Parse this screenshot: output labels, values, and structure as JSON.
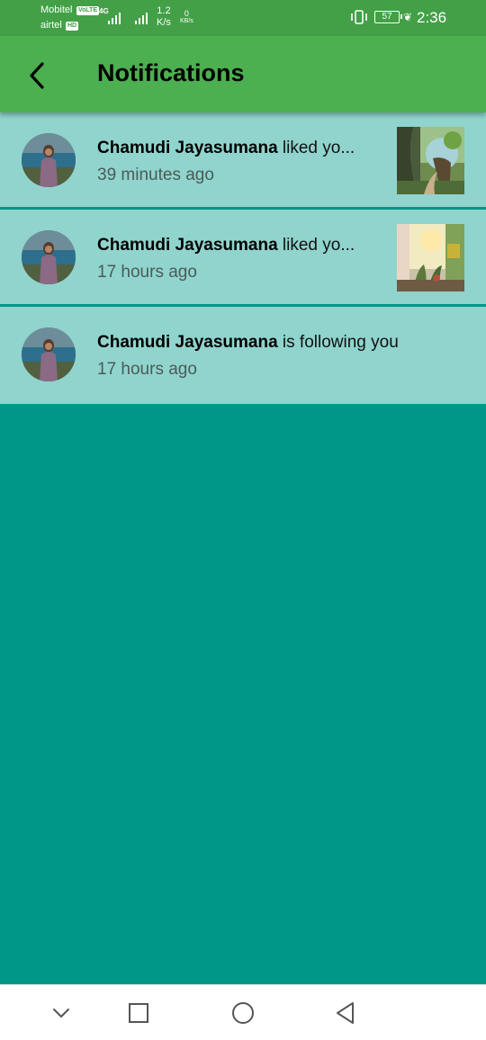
{
  "status_bar": {
    "carrier_1": "Mobitel",
    "carrier_1_tag": "VoLTE",
    "carrier_2": "airtel",
    "carrier_2_tag": "HD",
    "network_type": "4G",
    "speed_value": "1.2",
    "speed_unit": "K/s",
    "data_value": "0",
    "data_unit": "KB/s",
    "battery_level": "57",
    "time": "2:36"
  },
  "app_bar": {
    "title": "Notifications",
    "back_icon": "chevron-left-icon"
  },
  "notifications": [
    {
      "user": "Chamudi Jayasumana",
      "action": "liked yo...",
      "time": "39 minutes ago",
      "has_thumbnail": true
    },
    {
      "user": "Chamudi Jayasumana",
      "action": "liked yo...",
      "time": "17 hours ago",
      "has_thumbnail": true
    },
    {
      "user": "Chamudi Jayasumana",
      "action": "is following you",
      "time": "17 hours ago",
      "has_thumbnail": false
    }
  ],
  "nav_bar": {
    "icons": [
      "chevron-down-icon",
      "square-icon",
      "circle-icon",
      "triangle-back-icon"
    ]
  },
  "colors": {
    "status_bar": "#43a047",
    "app_bar": "#4caf50",
    "list_item": "#90d4cd",
    "background": "#009688"
  }
}
